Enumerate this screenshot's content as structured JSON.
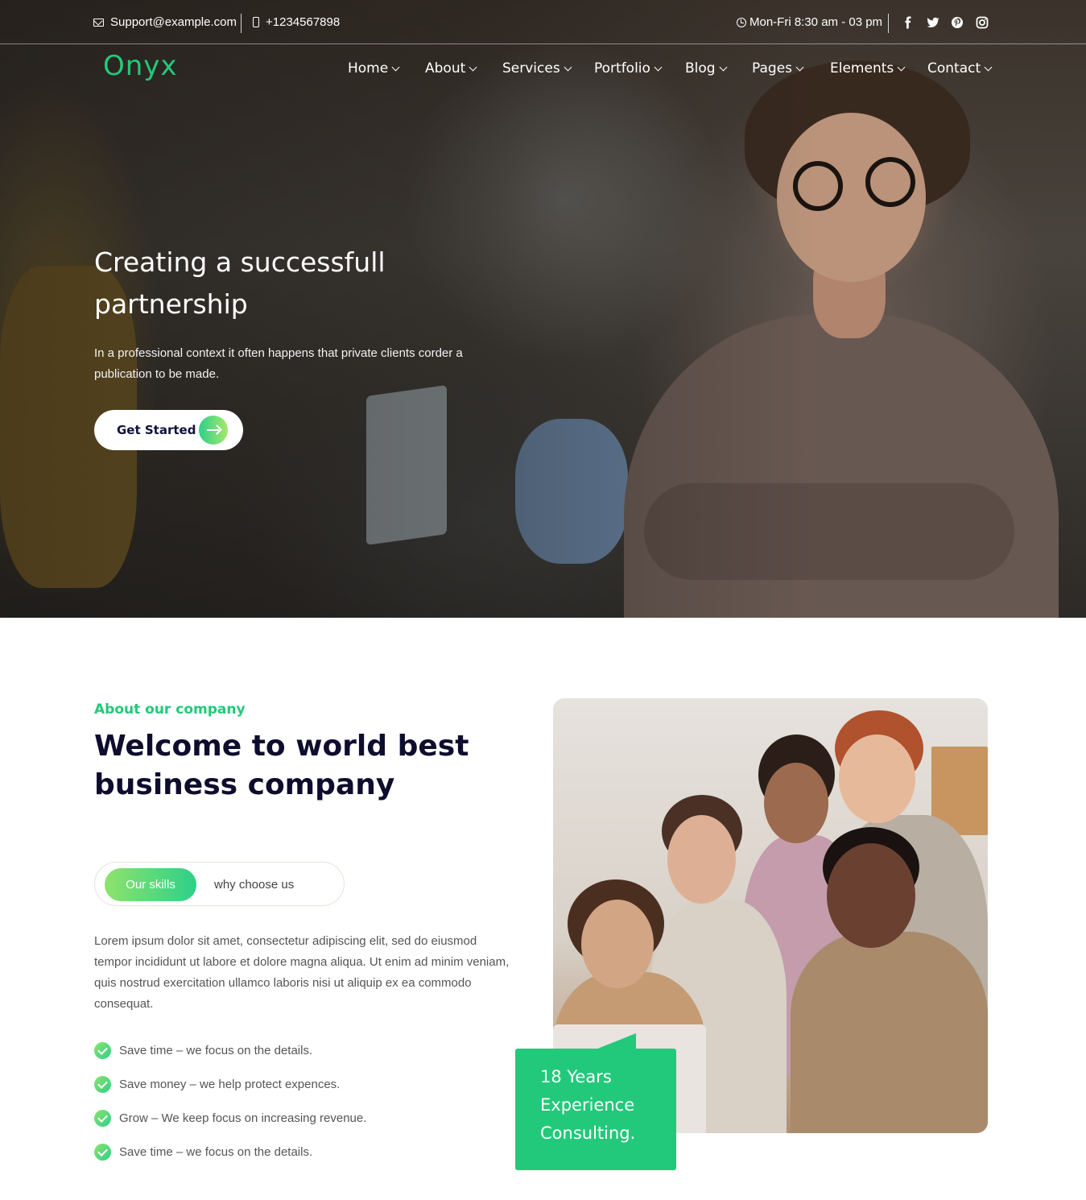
{
  "topbar": {
    "email": "Support@example.com",
    "phone": "+1234567898",
    "hours": "Mon-Fri 8:30 am - 03 pm",
    "socials": [
      "facebook-icon",
      "twitter-icon",
      "pinterest-icon",
      "instagram-icon"
    ]
  },
  "brand": {
    "logo": "Onyx",
    "accent": "#22c97a"
  },
  "nav": [
    {
      "label": "Home"
    },
    {
      "label": "About"
    },
    {
      "label": "Services"
    },
    {
      "label": "Portfolio"
    },
    {
      "label": "Blog"
    },
    {
      "label": "Pages"
    },
    {
      "label": "Elements"
    },
    {
      "label": "Contact"
    }
  ],
  "hero": {
    "title": "Creating a successfull partnership",
    "subtitle": "In a professional context it often happens that private clients corder a publication to be made.",
    "cta": "Get Started"
  },
  "about": {
    "eyebrow": "About our company",
    "title": "Welcome to world best business company",
    "tabs": [
      {
        "label": "Our skills",
        "active": true
      },
      {
        "label": "why choose us",
        "active": false
      }
    ],
    "paragraph": "Lorem ipsum dolor sit amet, consectetur adipiscing elit, sed do eiusmod tempor incididunt ut labore et dolore magna aliqua. Ut enim ad minim veniam, quis nostrud exercitation ullamco laboris nisi ut aliquip ex ea commodo consequat.",
    "checklist": [
      "Save time – we focus on the details.",
      "Save money – we help protect expences.",
      "Grow – We keep focus on increasing revenue.",
      "Save time – we focus on the details."
    ],
    "badge": [
      "18 Years",
      "Experience",
      "Consulting."
    ]
  }
}
